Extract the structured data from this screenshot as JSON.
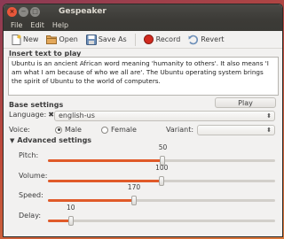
{
  "window": {
    "title": "Gespeaker"
  },
  "menu": [
    "File",
    "Edit",
    "Help"
  ],
  "toolbar": {
    "new_label": "New",
    "open_label": "Open",
    "save_label": "Save As",
    "record_label": "Record",
    "revert_label": "Revert"
  },
  "input_section": {
    "title": "Insert text to play",
    "text": "Ubuntu is an ancient African word meaning 'humanity to others'. It also means 'I am what I am because of who we all are'. The Ubuntu operating system brings the spirit of Ubuntu to the world of computers."
  },
  "play_label": "Play",
  "base": {
    "title": "Base settings",
    "language_label": "Language:",
    "language_value": "english-us",
    "voice_label": "Voice:",
    "male_label": "Male",
    "female_label": "Female",
    "voice_selected": "Male",
    "variant_label": "Variant:",
    "variant_value": ""
  },
  "advanced": {
    "title": "Advanced settings",
    "sliders": [
      {
        "label": "Pitch:",
        "value": 50,
        "max": 99
      },
      {
        "label": "Volume:",
        "value": 100,
        "max": 200
      },
      {
        "label": "Speed:",
        "value": 170,
        "max": 450
      },
      {
        "label": "Delay:",
        "value": 10,
        "max": 100
      }
    ]
  },
  "colors": {
    "accent": "#e05a29",
    "titlebar": "#3c3b37"
  }
}
